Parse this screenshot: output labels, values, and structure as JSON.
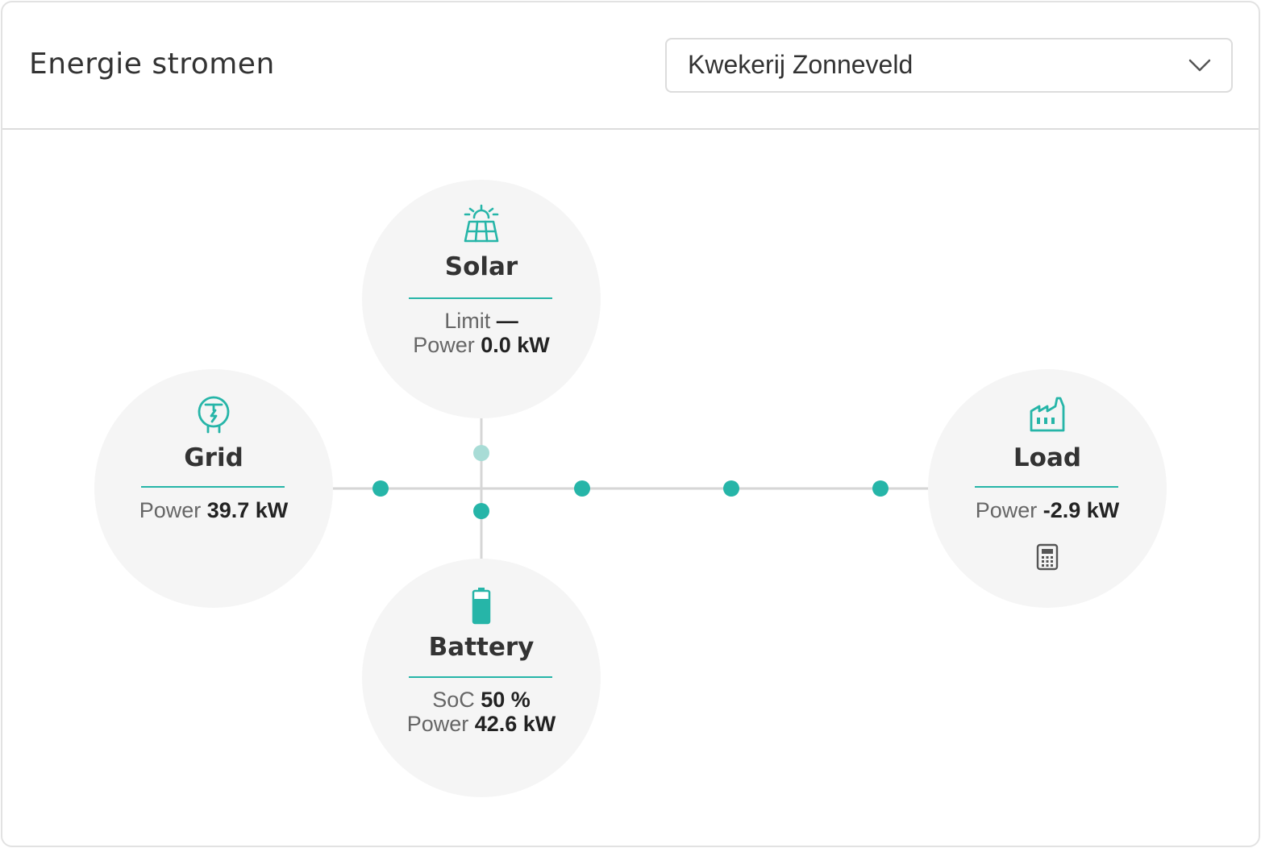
{
  "header": {
    "title": "Energie stromen",
    "site_select": {
      "value": "Kwekerij Zonneveld"
    }
  },
  "colors": {
    "accent": "#26b5a8",
    "accent_faded": "#a8dcd6",
    "line": "#d6d6d6",
    "node_bg": "#f5f5f5"
  },
  "nodes": {
    "solar": {
      "icon": "solar-panel-icon",
      "label": "Solar",
      "limit_label": "Limit",
      "limit_value": "—",
      "power_label": "Power",
      "power_value": "0.0 kW"
    },
    "grid": {
      "icon": "grid-meter-icon",
      "label": "Grid",
      "power_label": "Power",
      "power_value": "39.7 kW"
    },
    "battery": {
      "icon": "battery-icon",
      "label": "Battery",
      "soc_label": "SoC",
      "soc_value": "50 %",
      "power_label": "Power",
      "power_value": "42.6 kW"
    },
    "load": {
      "icon": "factory-icon",
      "label": "Load",
      "power_label": "Power",
      "power_value": "-2.9 kW",
      "extra_icon": "calculator-icon"
    }
  }
}
